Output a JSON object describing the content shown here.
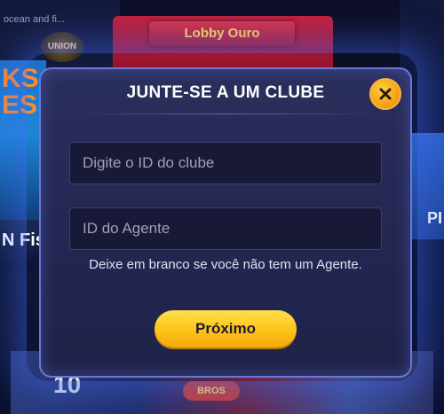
{
  "background": {
    "top_left_text": "ocean and fi...",
    "left_logo_text": "UNION",
    "left_game_text": "KS\nES",
    "left_game2_text": "N Fis",
    "top_card_label": "Lobby Ouro",
    "right_game_text": "PI",
    "bottom_badge_text": "BROS",
    "bottom_number_text": "10"
  },
  "modal": {
    "title": "JUNTE-SE A UM CLUBE",
    "close_icon": "close-icon",
    "club_id_placeholder": "Digite o ID do clube",
    "agent_id_placeholder": "ID do Agente",
    "hint": "Deixe em branco se você não tem um Agente.",
    "next_label": "Próximo"
  },
  "colors": {
    "modal_bg": "#2b2f5c",
    "modal_border": "#6a78d8",
    "button_yellow": "#ffc21a",
    "close_orange": "#f59a12"
  }
}
